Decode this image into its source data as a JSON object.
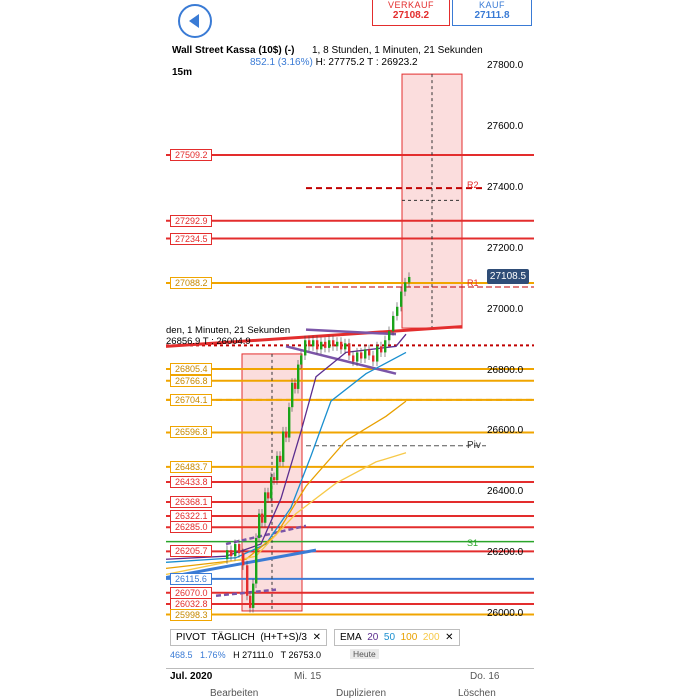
{
  "trade": {
    "sell_label": "VERKAUF",
    "sell_price": "27108.2",
    "buy_label": "KAUF",
    "buy_price": "27111.8"
  },
  "instrument": {
    "title": "Wall Street Kassa (10$) (-)",
    "countdown": "1, 8 Stunden, 1 Minuten, 21 Sekunden",
    "change": "852.1 (3.16%)",
    "high_low": "H: 27775.2 T : 26923.2",
    "timeframe": "15m"
  },
  "overlay_info": {
    "countdown": "den, 1 Minuten, 21 Sekunden",
    "high_low": "26856.9 T : 26004.9"
  },
  "y_axis": {
    "ticks": [
      "27800.0",
      "27600.0",
      "27400.0",
      "27200.0",
      "27000.0",
      "26800.0",
      "26600.0",
      "26400.0",
      "26200.0",
      "26000.0"
    ],
    "current_price": "27108.5"
  },
  "levels": [
    {
      "label": "27509.2",
      "color": "#e32d2d"
    },
    {
      "label": "27292.9",
      "color": "#e32d2d"
    },
    {
      "label": "27234.5",
      "color": "#e32d2d"
    },
    {
      "label": "27088.2",
      "color": "#f0a500"
    },
    {
      "label": "26805.4",
      "color": "#f0a500"
    },
    {
      "label": "26766.8",
      "color": "#f0a500"
    },
    {
      "label": "26704.1",
      "color": "#f0a500"
    },
    {
      "label": "26596.8",
      "color": "#f0a500"
    },
    {
      "label": "26483.7",
      "color": "#f0a500"
    },
    {
      "label": "26433.8",
      "color": "#e32d2d"
    },
    {
      "label": "26368.1",
      "color": "#e32d2d"
    },
    {
      "label": "26322.1",
      "color": "#e32d2d"
    },
    {
      "label": "26285.0",
      "color": "#e32d2d"
    },
    {
      "label": "26205.7",
      "color": "#e32d2d"
    },
    {
      "label": "26115.6",
      "color": "#3a7bd5"
    },
    {
      "label": "26070.0",
      "color": "#e32d2d"
    },
    {
      "label": "26032.8",
      "color": "#e32d2d"
    },
    {
      "label": "25998.3",
      "color": "#f0a500"
    }
  ],
  "pivot_labels": {
    "r2": "R2",
    "r1": "R1",
    "piv": "Piv",
    "s1": "S1"
  },
  "indicators": {
    "pivot": "PIVOT",
    "pivot_mode": "TÄGLICH",
    "pivot_formula": "(H+T+S)/3",
    "ema": "EMA",
    "ema_periods": [
      "20",
      "50",
      "100",
      "200"
    ],
    "ema_colors": [
      "#5b2d8e",
      "#1a8fcf",
      "#e8a000",
      "#f7c948"
    ]
  },
  "bottom_info": {
    "value": "468.5",
    "pct": "1.76%",
    "high": "H 27111.0",
    "low": "T 26753.0",
    "today": "Heute"
  },
  "x_axis": {
    "labels": [
      "Jul. 2020",
      "Mi. 15",
      "Do. 16"
    ]
  },
  "toolbar": {
    "edit": "Bearbeiten",
    "duplicate": "Duplizieren",
    "delete": "Löschen"
  }
}
